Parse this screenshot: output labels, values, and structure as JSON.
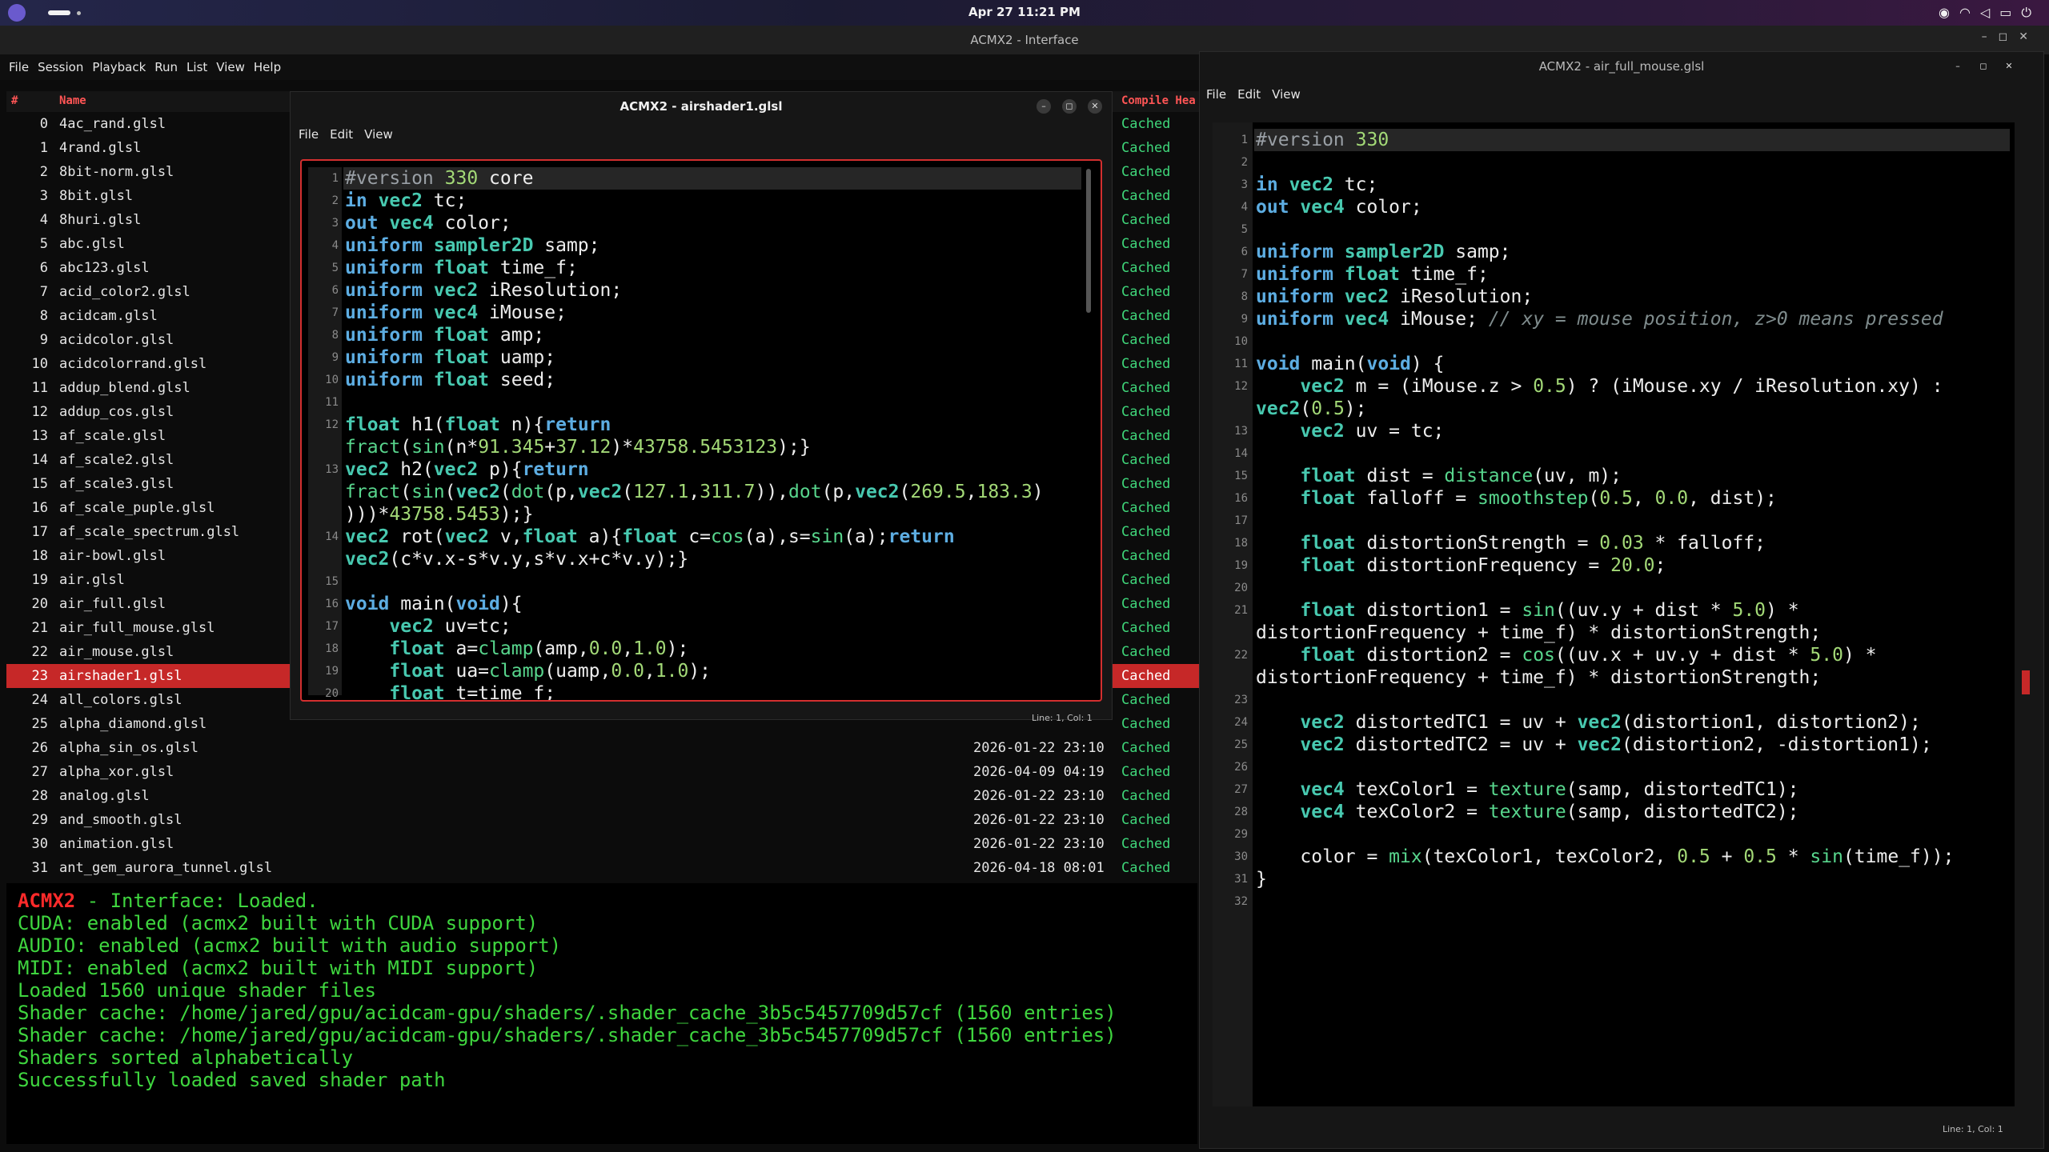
{
  "system": {
    "clock": "Apr 27  11:21 PM",
    "icons": [
      "steam-icon",
      "wifi-icon",
      "volume-icon",
      "battery-icon",
      "power-icon"
    ]
  },
  "main_window": {
    "title": "ACMX2 - Interface",
    "menu": [
      "File",
      "Session",
      "Playback",
      "Run",
      "List",
      "View",
      "Help"
    ],
    "columns": {
      "index": "#",
      "name": "Name",
      "status": "Compile Hea"
    },
    "selected_index": 23,
    "rows": [
      {
        "i": "0",
        "name": "4ac_rand.glsl",
        "date": "",
        "status": "Cached"
      },
      {
        "i": "1",
        "name": "4rand.glsl",
        "date": "",
        "status": "Cached"
      },
      {
        "i": "2",
        "name": "8bit-norm.glsl",
        "date": "",
        "status": "Cached"
      },
      {
        "i": "3",
        "name": "8bit.glsl",
        "date": "",
        "status": "Cached"
      },
      {
        "i": "4",
        "name": "8huri.glsl",
        "date": "",
        "status": "Cached"
      },
      {
        "i": "5",
        "name": "abc.glsl",
        "date": "",
        "status": "Cached"
      },
      {
        "i": "6",
        "name": "abc123.glsl",
        "date": "",
        "status": "Cached"
      },
      {
        "i": "7",
        "name": "acid_color2.glsl",
        "date": "",
        "status": "Cached"
      },
      {
        "i": "8",
        "name": "acidcam.glsl",
        "date": "",
        "status": "Cached"
      },
      {
        "i": "9",
        "name": "acidcolor.glsl",
        "date": "",
        "status": "Cached"
      },
      {
        "i": "10",
        "name": "acidcolorrand.glsl",
        "date": "",
        "status": "Cached"
      },
      {
        "i": "11",
        "name": "addup_blend.glsl",
        "date": "",
        "status": "Cached"
      },
      {
        "i": "12",
        "name": "addup_cos.glsl",
        "date": "",
        "status": "Cached"
      },
      {
        "i": "13",
        "name": "af_scale.glsl",
        "date": "",
        "status": "Cached"
      },
      {
        "i": "14",
        "name": "af_scale2.glsl",
        "date": "",
        "status": "Cached"
      },
      {
        "i": "15",
        "name": "af_scale3.glsl",
        "date": "",
        "status": "Cached"
      },
      {
        "i": "16",
        "name": "af_scale_puple.glsl",
        "date": "",
        "status": "Cached"
      },
      {
        "i": "17",
        "name": "af_scale_spectrum.glsl",
        "date": "",
        "status": "Cached"
      },
      {
        "i": "18",
        "name": "air-bowl.glsl",
        "date": "",
        "status": "Cached"
      },
      {
        "i": "19",
        "name": "air.glsl",
        "date": "",
        "status": "Cached"
      },
      {
        "i": "20",
        "name": "air_full.glsl",
        "date": "",
        "status": "Cached"
      },
      {
        "i": "21",
        "name": "air_full_mouse.glsl",
        "date": "",
        "status": "Cached"
      },
      {
        "i": "22",
        "name": "air_mouse.glsl",
        "date": "",
        "status": "Cached"
      },
      {
        "i": "23",
        "name": "airshader1.glsl",
        "date": "",
        "status": "Cached"
      },
      {
        "i": "24",
        "name": "all_colors.glsl",
        "date": "",
        "status": "Cached"
      },
      {
        "i": "25",
        "name": "alpha_diamond.glsl",
        "date": "",
        "status": "Cached"
      },
      {
        "i": "26",
        "name": "alpha_sin_os.glsl",
        "date": "2026-01-22 23:10",
        "status": "Cached"
      },
      {
        "i": "27",
        "name": "alpha_xor.glsl",
        "date": "2026-04-09 04:19",
        "status": "Cached"
      },
      {
        "i": "28",
        "name": "analog.glsl",
        "date": "2026-01-22 23:10",
        "status": "Cached"
      },
      {
        "i": "29",
        "name": "and_smooth.glsl",
        "date": "2026-01-22 23:10",
        "status": "Cached"
      },
      {
        "i": "30",
        "name": "animation.glsl",
        "date": "2026-01-22 23:10",
        "status": "Cached"
      },
      {
        "i": "31",
        "name": "ant_gem_aurora_tunnel.glsl",
        "date": "2026-04-18 08:01",
        "status": "Cached"
      }
    ],
    "console": {
      "brand": "ACMX2",
      "first_line_rest": " - Interface: Loaded.",
      "lines": [
        "CUDA: enabled (acmx2 built with CUDA support)",
        "AUDIO: enabled (acmx2 built with audio support)",
        "MIDI: enabled (acmx2 built with MIDI support)",
        "Loaded 1560 unique shader files",
        "Shader cache: /home/jared/gpu/acidcam-gpu/shaders/.shader_cache_3b5c5457709d57cf (1560 entries)",
        "Shader cache: /home/jared/gpu/acidcam-gpu/shaders/.shader_cache_3b5c5457709d57cf (1560 entries)",
        "Shaders sorted alphabetically",
        "Successfully loaded saved shader path"
      ]
    }
  },
  "editor1": {
    "title": "ACMX2 - airshader1.glsl",
    "menu": [
      "File",
      "Edit",
      "View"
    ],
    "status": "Line: 1, Col: 1",
    "gutter": [
      "1",
      "2",
      "3",
      "4",
      "5",
      "6",
      "7",
      "8",
      "9",
      "10",
      "11",
      "12",
      "",
      "13",
      "",
      "",
      "14",
      "",
      "15",
      "16",
      "17",
      "18",
      "19",
      "20"
    ],
    "code_html": "<span class=\"pp\">#version</span> <span class=\"num\">330</span> core\n<span class=\"kw\">in</span> <span class=\"ty\">vec2</span> tc;\n<span class=\"kw\">out</span> <span class=\"ty\">vec4</span> color;\n<span class=\"kw\">uniform</span> <span class=\"ty\">sampler2D</span> samp;\n<span class=\"kw\">uniform</span> <span class=\"ty\">float</span> time_f;\n<span class=\"kw\">uniform</span> <span class=\"ty\">vec2</span> iResolution;\n<span class=\"kw\">uniform</span> <span class=\"ty\">vec4</span> iMouse;\n<span class=\"kw\">uniform</span> <span class=\"ty\">float</span> amp;\n<span class=\"kw\">uniform</span> <span class=\"ty\">float</span> uamp;\n<span class=\"kw\">uniform</span> <span class=\"ty\">float</span> seed;\n\n<span class=\"ty\">float</span> h1(<span class=\"ty\">float</span> n){<span class=\"kw\">return</span>\n<span class=\"fn\">fract</span>(<span class=\"fn\">sin</span>(n*<span class=\"num\">91.345</span>+<span class=\"num\">37.12</span>)*<span class=\"num\">43758.5453123</span>);}\n<span class=\"ty\">vec2</span> h2(<span class=\"ty\">vec2</span> p){<span class=\"kw\">return</span>\n<span class=\"fn\">fract</span>(<span class=\"fn\">sin</span>(<span class=\"ty\">vec2</span>(<span class=\"fn\">dot</span>(p,<span class=\"ty\">vec2</span>(<span class=\"num\">127.1</span>,<span class=\"num\">311.7</span>)),<span class=\"fn\">dot</span>(p,<span class=\"ty\">vec2</span>(<span class=\"num\">269.5</span>,<span class=\"num\">183.3</span>)\n)))*<span class=\"num\">43758.5453</span>);}\n<span class=\"ty\">vec2</span> rot(<span class=\"ty\">vec2</span> v,<span class=\"ty\">float</span> a){<span class=\"ty\">float</span> c=<span class=\"fn\">cos</span>(a),s=<span class=\"fn\">sin</span>(a);<span class=\"kw\">return</span>\n<span class=\"ty\">vec2</span>(c*v.x-s*v.y,s*v.x+c*v.y);}\n\n<span class=\"kw\">void</span> main(<span class=\"kw\">void</span>){\n    <span class=\"ty\">vec2</span> uv=tc;\n    <span class=\"ty\">float</span> a=<span class=\"fn\">clamp</span>(amp,<span class=\"num\">0.0</span>,<span class=\"num\">1.0</span>);\n    <span class=\"ty\">float</span> ua=<span class=\"fn\">clamp</span>(uamp,<span class=\"num\">0.0</span>,<span class=\"num\">1.0</span>);\n    <span class=\"ty\">float</span> t=time_f;"
  },
  "editor2": {
    "title": "ACMX2 - air_full_mouse.glsl",
    "menu": [
      "File",
      "Edit",
      "View"
    ],
    "status": "Line: 1, Col: 1",
    "gutter": [
      "1",
      "2",
      "3",
      "4",
      "5",
      "6",
      "7",
      "8",
      "9",
      "10",
      "11",
      "12",
      "",
      "13",
      "14",
      "15",
      "16",
      "17",
      "18",
      "19",
      "20",
      "21",
      "",
      "22",
      "",
      "23",
      "24",
      "25",
      "26",
      "27",
      "28",
      "29",
      "30",
      "31",
      "32"
    ],
    "code_html": "<span class=\"pp\">#version</span> <span class=\"num\">330</span>\n\n<span class=\"kw\">in</span> <span class=\"ty\">vec2</span> tc;\n<span class=\"kw\">out</span> <span class=\"ty\">vec4</span> color;\n\n<span class=\"kw\">uniform</span> <span class=\"ty\">sampler2D</span> samp;\n<span class=\"kw\">uniform</span> <span class=\"ty\">float</span> time_f;\n<span class=\"kw\">uniform</span> <span class=\"ty\">vec2</span> iResolution;\n<span class=\"kw\">uniform</span> <span class=\"ty\">vec4</span> iMouse; <span class=\"cm\">// xy = mouse position, z>0 means pressed</span>\n\n<span class=\"kw\">void</span> main(<span class=\"kw\">void</span>) {\n    <span class=\"ty\">vec2</span> m = (iMouse.z &gt; <span class=\"num\">0.5</span>) ? (iMouse.xy / iResolution.xy) :\n<span class=\"ty\">vec2</span>(<span class=\"num\">0.5</span>);\n    <span class=\"ty\">vec2</span> uv = tc;\n\n    <span class=\"ty\">float</span> dist = <span class=\"fn\">distance</span>(uv, m);\n    <span class=\"ty\">float</span> falloff = <span class=\"fn\">smoothstep</span>(<span class=\"num\">0.5</span>, <span class=\"num\">0.0</span>, dist);\n\n    <span class=\"ty\">float</span> distortionStrength = <span class=\"num\">0.03</span> * falloff;\n    <span class=\"ty\">float</span> distortionFrequency = <span class=\"num\">20.0</span>;\n\n    <span class=\"ty\">float</span> distortion1 = <span class=\"fn\">sin</span>((uv.y + dist * <span class=\"num\">5.0</span>) *\ndistortionFrequency + time_f) * distortionStrength;\n    <span class=\"ty\">float</span> distortion2 = <span class=\"fn\">cos</span>((uv.x + uv.y + dist * <span class=\"num\">5.0</span>) *\ndistortionFrequency + time_f) * distortionStrength;\n\n    <span class=\"ty\">vec2</span> distortedTC1 = uv + <span class=\"ty\">vec2</span>(distortion1, distortion2);\n    <span class=\"ty\">vec2</span> distortedTC2 = uv + <span class=\"ty\">vec2</span>(distortion2, -distortion1);\n\n    <span class=\"ty\">vec4</span> texColor1 = <span class=\"fn\">texture</span>(samp, distortedTC1);\n    <span class=\"ty\">vec4</span> texColor2 = <span class=\"fn\">texture</span>(samp, distortedTC2);\n\n    color = <span class=\"fn\">mix</span>(texColor1, texColor2, <span class=\"num\">0.5</span> + <span class=\"num\">0.5</span> * <span class=\"fn\">sin</span>(time_f));\n}\n"
  }
}
